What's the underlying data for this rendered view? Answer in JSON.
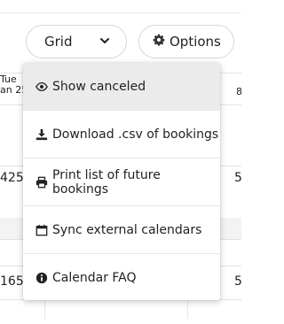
{
  "view_select": {
    "value": "Grid",
    "icon": "chevron-down-icon"
  },
  "options_button": {
    "label": "Options",
    "icon": "gear-icon"
  },
  "calendar": {
    "day_header": {
      "weekday": "Tue",
      "date": "an 25"
    },
    "right_header": "8",
    "cells": [
      "425",
      "5",
      "165",
      "5"
    ]
  },
  "menu": {
    "items": [
      {
        "label": "Show canceled",
        "icon": "eye-icon"
      },
      {
        "label": "Download .csv of bookings",
        "icon": "download-icon"
      },
      {
        "label": "Print list of future bookings",
        "icon": "printer-icon"
      },
      {
        "label": "Sync external calendars",
        "icon": "calendar-icon"
      },
      {
        "label": "Calendar FAQ",
        "icon": "info-icon"
      }
    ]
  }
}
